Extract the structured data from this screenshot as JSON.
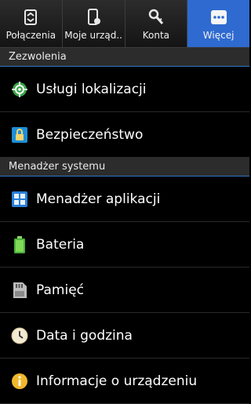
{
  "tabs": [
    {
      "label": "Połączenia",
      "icon": "connections-icon"
    },
    {
      "label": "Moje urząd..",
      "icon": "my-device-icon"
    },
    {
      "label": "Konta",
      "icon": "accounts-icon"
    },
    {
      "label": "Więcej",
      "icon": "more-icon",
      "active": true
    }
  ],
  "sections": [
    {
      "title": "Zezwolenia",
      "items": [
        {
          "label": "Usługi lokalizacji",
          "icon": "location-icon"
        },
        {
          "label": "Bezpieczeństwo",
          "icon": "lock-icon"
        }
      ]
    },
    {
      "title": "Menadżer systemu",
      "items": [
        {
          "label": "Menadżer aplikacji",
          "icon": "apps-icon"
        },
        {
          "label": "Bateria",
          "icon": "battery-icon"
        },
        {
          "label": "Pamięć",
          "icon": "sd-card-icon"
        },
        {
          "label": "Data i godzina",
          "icon": "clock-icon"
        },
        {
          "label": "Informacje o urządzeniu",
          "icon": "info-icon"
        }
      ]
    }
  ],
  "colors": {
    "active_tab": "#2e6ad0",
    "section_rule": "#2c77c9"
  }
}
